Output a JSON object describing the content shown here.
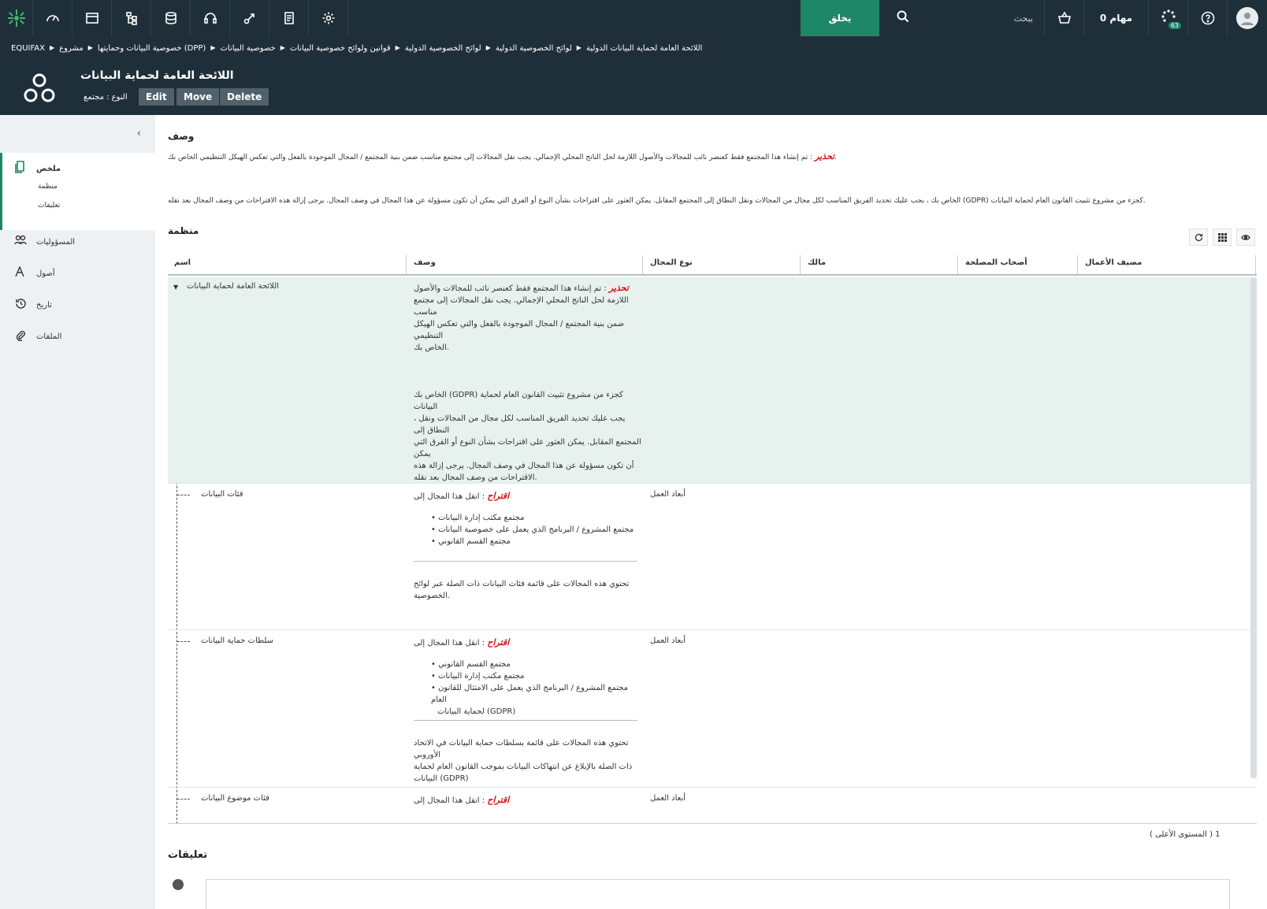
{
  "topbar": {
    "create_label": "يخلق",
    "search_placeholder": "يبحث",
    "tasks_label": "مهام 0",
    "notification_count": "63",
    "accent": "#1e8767"
  },
  "breadcrumb": [
    "EQUIFAX",
    "مشروع",
    "خصوصية البيانات وحمايتها (DPP)",
    "خصوصية البيانات",
    "قوانين ولوائح خصوصية البيانات",
    "لوائح الخصوصية الدولية",
    "لوائح الخصوصية الدولية",
    "اللائحة العامة لحماية البيانات الدولية"
  ],
  "header": {
    "title": "اللائحة العامة لحماية البيانات",
    "type_label": "النوع : مجتمع",
    "buttons": {
      "edit": "Edit",
      "move": "Move",
      "delete": "Delete"
    }
  },
  "sidebar": {
    "summary": "ملخص",
    "sub_org": "منظمة",
    "sub_comments": "تعليقات",
    "responsibilities": "المسؤوليات",
    "assets": "أصول",
    "history": "تاريخ",
    "files": "الملفات"
  },
  "description": {
    "title": "وصف",
    "warning_label": "تحذير",
    "warning_text": ": تم إنشاء هذا المجتمع فقط كعنصر نائب للمجالات والأصول اللازمة لحل الناتج المحلي الإجمالي. يجب نقل المجالات إلى مجتمع مناسب ضمن بنية المجتمع / المجال الموجودة بالفعل والتي تعكس الهيكل التنظيمي الخاص بك.",
    "note": "الخاص بك ، يجب عليك تحديد الفريق المناسب لكل مجال من المجالات ونقل النطاق إلى المجتمع المقابل. يمكن العثور على اقتراحات بشأن النوع أو الفرق التي يمكن أن تكون مسؤولة عن هذا المجال في وصف المجال. يرجى إزالة هذه الاقتراحات من وصف المجال بعد نقله (GDPR) كجزء من مشروع تثبيت القانون العام لحماية البيانات."
  },
  "organization": {
    "title": "منظمة",
    "columns": {
      "name": "اسم",
      "description": "وصف",
      "domain_type": "نوع المجال",
      "owner": "مالك",
      "stakeholders": "أصحاب المصلحة",
      "business_steward": "مضيف الأعمال"
    },
    "rows": [
      {
        "name": "اللائحة العامة لحماية البيانات",
        "desc_warning": "تحذير",
        "desc_lines": [
          ": تم إنشاء هذا المجتمع فقط كعنصر نائب للمجالات والأصول",
          "اللازمة لحل الناتج المحلي الإجمالي. يجب نقل المجالات إلى مجتمع مناسب",
          "ضمن بنية المجتمع / المجال الموجودة بالفعل والتي تعكس الهيكل التنظيمي",
          "الخاص بك."
        ],
        "desc_lines2": [
          "الخاص بك (GDPR) كجزء من مشروع تثبيت القانون العام لحماية البيانات",
          "، يجب عليك تحديد الفريق المناسب لكل مجال من المجالات ونقل النطاق إلى",
          "المجتمع المقابل. يمكن العثور على اقتراحات بشأن النوع أو الفرق التي يمكن",
          "أن تكون مسؤولة عن هذا المجال في وصف المجال. يرجى إزالة هذه",
          "الاقتراحات من وصف المجال بعد نقله."
        ],
        "type": ""
      },
      {
        "name": "فئات البيانات",
        "suggest_label": "اقتراح",
        "suggest_text": ": انقل هذا المجال إلى",
        "bullets": [
          "مجتمع مكتب إدارة البيانات",
          "مجتمع المشروع / البرنامج الذي يعمل على خصوصية البيانات",
          "مجتمع القسم القانوني"
        ],
        "footer_lines": [
          "تحتوي هذه المجالات على قائمة فئات البيانات ذات الصلة عبر لوائح",
          "الخصوصية."
        ],
        "type": "أبعاد العمل"
      },
      {
        "name": "سلطات حماية البيانات",
        "suggest_label": "اقتراح",
        "suggest_text": ": انقل هذا المجال إلى",
        "bullets": [
          "مجتمع القسم القانوني",
          "مجتمع مكتب إدارة البيانات",
          "مجتمع المشروع / البرنامج الذي يعمل على الامتثال للقانون العام",
          "لحماية البيانات (GDPR)"
        ],
        "footer_lines": [
          "تحتوي هذه المجالات على قائمة بسلطات حماية البيانات في الاتحاد الأوروبي",
          "ذات الصلة بالإبلاغ عن انتهاكات البيانات بموجب القانون العام لحماية",
          "البيانات (GDPR)"
        ],
        "type": "أبعاد العمل"
      },
      {
        "name": "فئات موضوع البيانات",
        "suggest_label": "اقتراح",
        "suggest_text": ": انقل هذا المجال إلى",
        "type": "أبعاد العمل"
      }
    ],
    "levels_label": "( المستوى الأعلى ) 1"
  },
  "comments": {
    "title": "تعليقات"
  }
}
